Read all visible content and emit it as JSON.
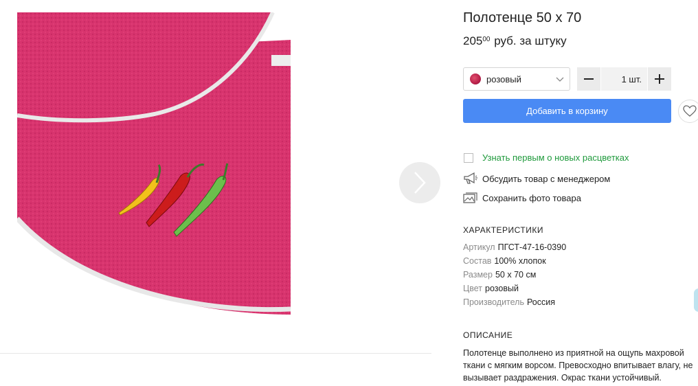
{
  "product": {
    "title": "Полотенце 50 х 70",
    "price_int": "205",
    "price_cents": "00",
    "price_suffix": " руб. за штуку"
  },
  "gallery": {
    "image_alt": "pink-towel-with-chili-peppers-embroidery-icon",
    "next_icon": "chevron-right-icon"
  },
  "purchase": {
    "color": "розовый",
    "color_swatch": "#c12a55",
    "quantity": "1 шт.",
    "minus_icon": "minus-icon",
    "plus_icon": "plus-icon",
    "add_to_cart": "Добавить в корзину",
    "accent": "#4a8af4"
  },
  "actions": [
    {
      "label": "Узнать первым о новых расцветках",
      "icon": "checkbox"
    },
    {
      "label": "Обсудить товар с менеджером",
      "icon": "megaphone-icon"
    },
    {
      "label": "Сохранить фото товара",
      "icon": "photo-icon"
    }
  ],
  "specs": {
    "heading": "ХАРАКТЕРИСТИКИ",
    "rows": [
      {
        "key": "Артикул",
        "value": "ПГСТ-47-16-0390"
      },
      {
        "key": "Состав",
        "value": "100% хлопок"
      },
      {
        "key": "Размер",
        "value": "50 х 70 см"
      },
      {
        "key": "Цвет",
        "value": "розовый"
      },
      {
        "key": "Производитель",
        "value": "Россия"
      }
    ]
  },
  "description": {
    "heading": "ОПИСАНИЕ",
    "text": "Полотенце выполнено из приятной на ощупь махровой ткани с мягким ворсом. Превосходно впитывает влагу, не вызывает раздражения. Окрас ткани устойчивый."
  }
}
